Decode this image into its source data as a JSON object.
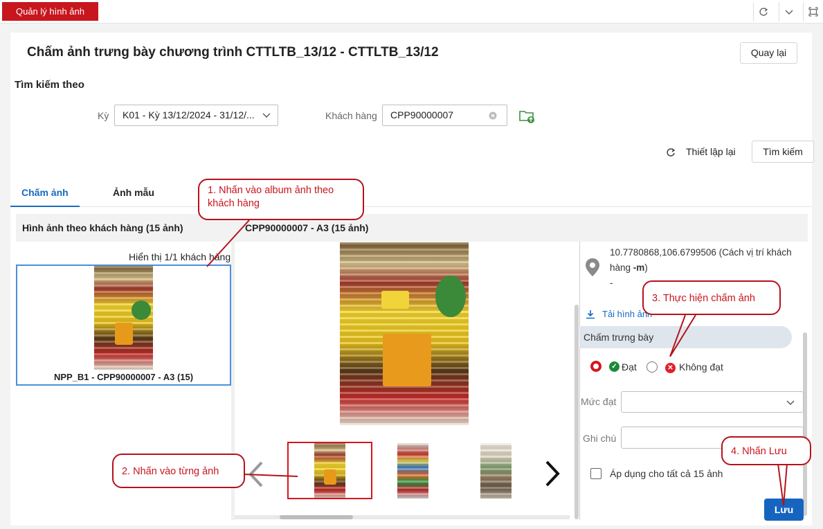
{
  "app": {
    "tab_label": "Quản lý hình ảnh"
  },
  "window": {
    "icons": [
      "refresh-icon",
      "chevron-down-icon",
      "maximize-icon"
    ]
  },
  "header": {
    "title": "Chấm ảnh trưng bày chương trình CTTLTB_13/12 - CTTLTB_13/12",
    "back_label": "Quay lại"
  },
  "search": {
    "title": "Tìm kiếm theo",
    "period_label": "Kỳ",
    "period_value": "K01 - Kỳ 13/12/2024 - 31/12/...",
    "customer_label": "Khách hàng",
    "customer_value": "CPP90000007",
    "reset_label": "Thiết lập lại",
    "search_label": "Tìm kiếm"
  },
  "tabs": [
    {
      "label": "Chấm ảnh",
      "active": true
    },
    {
      "label": "Ảnh mẫu",
      "active": false
    }
  ],
  "album_panel": {
    "heading": "Hình ảnh theo khách hàng (15 ảnh)",
    "display_text": "Hiển thị 1/1 khách hàng",
    "album_caption": "NPP_B1 - CPP90000007 - A3 (15)"
  },
  "viewer": {
    "heading": "CPP90000007 - A3 (15 ảnh)",
    "thumbnail_count": 3
  },
  "details": {
    "coords": "10.7780868,106.6799506 (Cách vị trí khách hàng ",
    "coords_unit": "-m",
    "coords_suffix": ")",
    "dash": "-",
    "download_label": "Tải hình ảnh",
    "section_label": "Chấm trưng bày",
    "pass_label": "Đạt",
    "fail_label": "Không đạt",
    "level_label": "Mức đạt",
    "note_label": "Ghi chú",
    "apply_all_label": "Áp dụng cho tất cả 15 ảnh",
    "save_label": "Lưu"
  },
  "callouts": {
    "step1": "1. Nhấn vào album ảnh theo khách hàng",
    "step2": "2. Nhấn vào từng ảnh",
    "step3": "3. Thực hiện chấm ảnh",
    "step4": "4. Nhấn Lưu"
  },
  "colors": {
    "brand_red": "#c8161e",
    "primary_blue": "#1565c0",
    "selected_border": "#4a8fdb",
    "pass_green": "#1a8a3a",
    "fail_red": "#e0202a"
  }
}
